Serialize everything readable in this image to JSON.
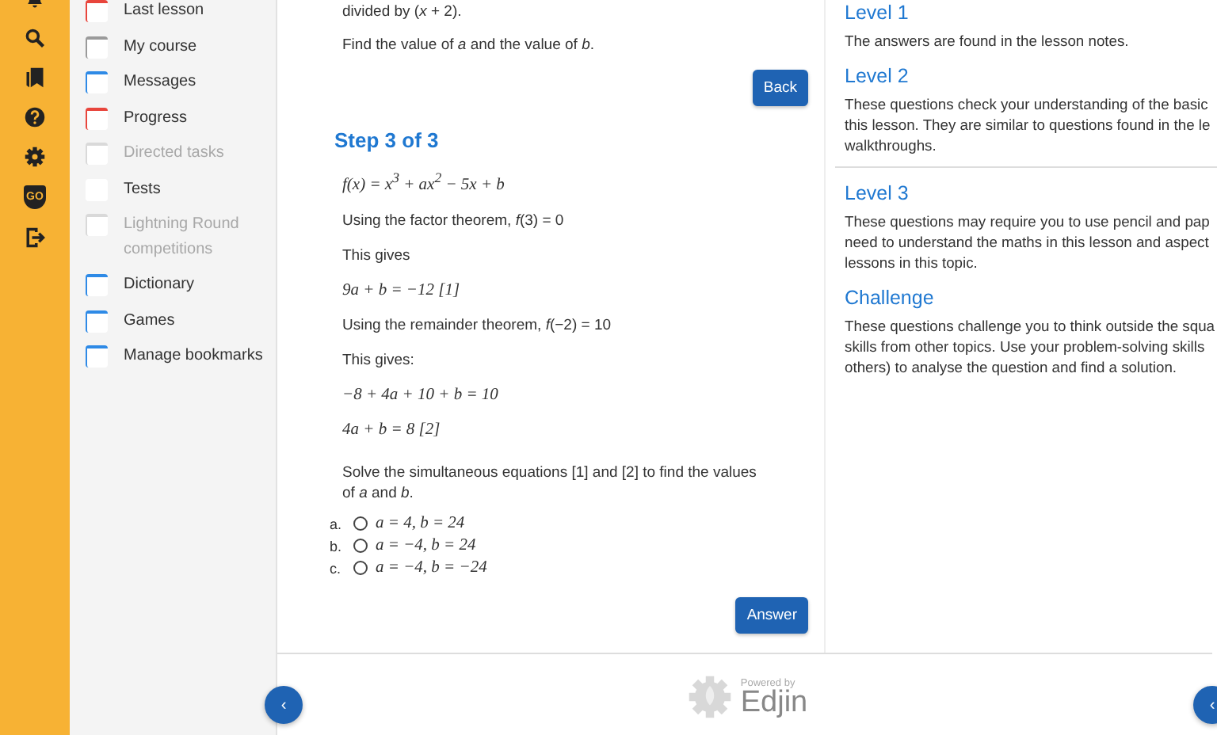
{
  "rail": [
    {
      "kind": "bell"
    },
    {
      "kind": "search"
    },
    {
      "kind": "bookmarks"
    },
    {
      "kind": "help"
    },
    {
      "kind": "settings"
    },
    {
      "kind": "badge",
      "label": "GO"
    },
    {
      "kind": "logout"
    }
  ],
  "menu": [
    {
      "label": "Last lesson",
      "disabled": false,
      "color": "#e8453c"
    },
    {
      "label": "My course",
      "disabled": false,
      "color": "#9a9a9a"
    },
    {
      "label": "Messages",
      "disabled": false,
      "color": "#2e8ae6"
    },
    {
      "label": "Progress",
      "disabled": false,
      "color": "#e8453c"
    },
    {
      "label": "Directed tasks",
      "disabled": true,
      "color": "#d9d9d9"
    },
    {
      "label": "Tests",
      "disabled": false,
      "color": "#ffffff"
    },
    {
      "label": "Lightning Round competitions",
      "disabled": true,
      "color": "#d9d9d9"
    },
    {
      "label": "Dictionary",
      "disabled": false,
      "color": "#2e8ae6"
    },
    {
      "label": "Games",
      "disabled": false,
      "color": "#2e8ae6"
    },
    {
      "label": "Manage bookmarks",
      "disabled": false,
      "color": "#2e8ae6"
    }
  ],
  "question": {
    "intro": "divided by (*x* + 2).",
    "prompt": "Find the value of *a* and the value of *b*.",
    "back_button": "Back",
    "step_title": "Step 3 of 3",
    "lines": [
      {
        "kind": "math",
        "text": "f(x) = x$^{3}$ + ax$^{2}$ − 5x + b"
      },
      {
        "kind": "text",
        "text": "Using the factor theorem, *f*(3) = 0"
      },
      {
        "kind": "text",
        "text": "This gives"
      },
      {
        "kind": "math",
        "text": "9a + b = −12     [1]"
      },
      {
        "kind": "text",
        "text": "Using the remainder theorem, *f*(−2) = 10"
      },
      {
        "kind": "text",
        "text": "This gives:"
      },
      {
        "kind": "math",
        "text": "−8 + 4a + 10 + b = 10"
      },
      {
        "kind": "math",
        "text": "4a + b = 8     [2]"
      }
    ],
    "instruction": "Solve the simultaneous equations [1] and [2] to find the values of *a* and *b*.",
    "options": [
      {
        "label": "a.",
        "text": "a = 4, b = 24",
        "selected": false
      },
      {
        "label": "b.",
        "text": "a = −4, b = 24",
        "selected": false
      },
      {
        "label": "c.",
        "text": "a = −4, b = −24",
        "selected": false
      }
    ],
    "answer_button": "Answer"
  },
  "levels": [
    {
      "title": "Level 1",
      "lines": [
        "The answers are found in the lesson notes."
      ],
      "divider": false
    },
    {
      "title": "Level 2",
      "lines": [
        "These questions check your understanding of the basic",
        "this lesson. They are similar to questions found in the le",
        "walkthroughs."
      ],
      "divider": true
    },
    {
      "title": "Level 3",
      "lines": [
        "These questions may require you to use pencil and pap",
        "need to understand the maths in this lesson and aspect",
        "lessons in this topic."
      ],
      "divider": false
    },
    {
      "title": "Challenge",
      "lines": [
        "These questions challenge you to think outside the squa",
        "skills from other topics. Use your problem-solving skills",
        "others) to analyse the question and find a solution."
      ],
      "divider": false
    }
  ],
  "footer": {
    "prev_button": "‹",
    "powered_by": "Powered by",
    "brand": "Edjin",
    "next_button": "‹"
  }
}
